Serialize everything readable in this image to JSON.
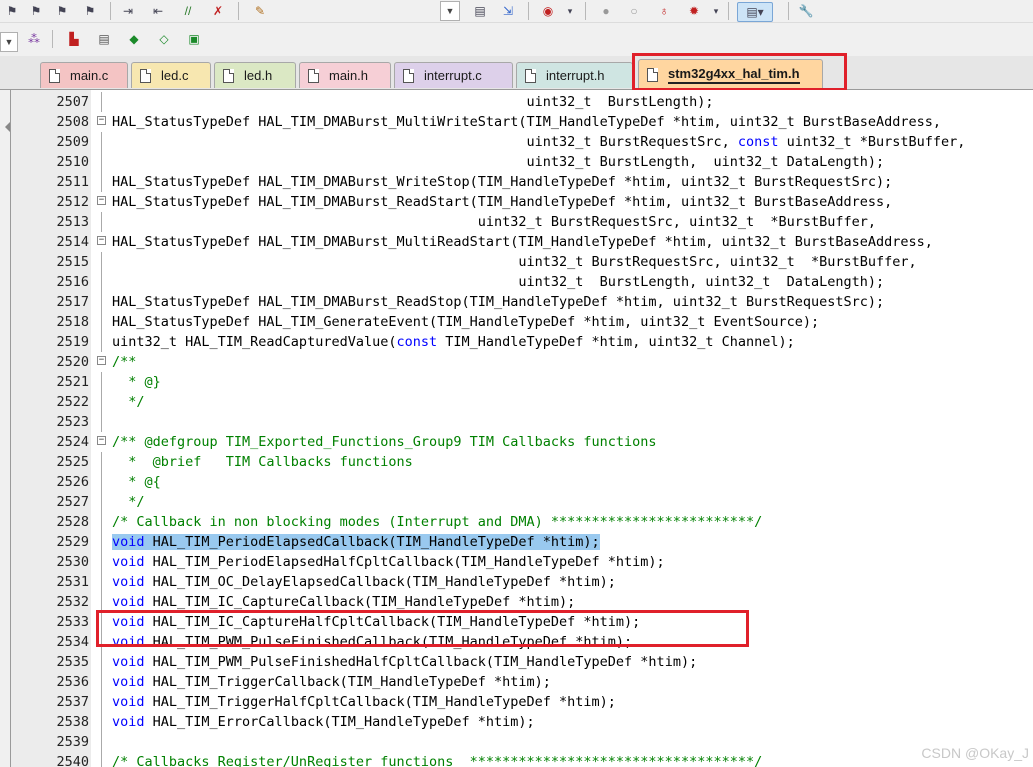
{
  "tabs": [
    {
      "label": "main.c",
      "color": "#f4c4c4",
      "active": false
    },
    {
      "label": "led.c",
      "color": "#f7e7b0",
      "active": false
    },
    {
      "label": "led.h",
      "color": "#dbe8c4",
      "active": false
    },
    {
      "label": "main.h",
      "color": "#f6cfd6",
      "active": false
    },
    {
      "label": "interrupt.c",
      "color": "#ddd0ea",
      "active": false
    },
    {
      "label": "interrupt.h",
      "color": "#cfe5e2",
      "active": false
    },
    {
      "label": "stm32g4xx_hal_tim.h",
      "color": "#ffd6a0",
      "active": true
    }
  ],
  "editor": {
    "lines": [
      {
        "num": "2507",
        "text": "                                                   uint32_t  BurstLength);"
      },
      {
        "num": "2508",
        "text": "HAL_StatusTypeDef HAL_TIM_DMABurst_MultiWriteStart(TIM_HandleTypeDef *htim, uint32_t BurstBaseAddress,"
      },
      {
        "num": "2509",
        "text": "                                                   uint32_t BurstRequestSrc, const uint32_t *BurstBuffer,"
      },
      {
        "num": "2510",
        "text": "                                                   uint32_t BurstLength,  uint32_t DataLength);"
      },
      {
        "num": "2511",
        "text": "HAL_StatusTypeDef HAL_TIM_DMABurst_WriteStop(TIM_HandleTypeDef *htim, uint32_t BurstRequestSrc);"
      },
      {
        "num": "2512",
        "text": "HAL_StatusTypeDef HAL_TIM_DMABurst_ReadStart(TIM_HandleTypeDef *htim, uint32_t BurstBaseAddress,"
      },
      {
        "num": "2513",
        "text": "                                             uint32_t BurstRequestSrc, uint32_t  *BurstBuffer,"
      },
      {
        "num": "2514",
        "text": "HAL_StatusTypeDef HAL_TIM_DMABurst_MultiReadStart(TIM_HandleTypeDef *htim, uint32_t BurstBaseAddress,"
      },
      {
        "num": "2515",
        "text": "                                                  uint32_t BurstRequestSrc, uint32_t  *BurstBuffer,"
      },
      {
        "num": "2516",
        "text": "                                                  uint32_t  BurstLength, uint32_t  DataLength);"
      },
      {
        "num": "2517",
        "text": "HAL_StatusTypeDef HAL_TIM_DMABurst_ReadStop(TIM_HandleTypeDef *htim, uint32_t BurstRequestSrc);"
      },
      {
        "num": "2518",
        "text": "HAL_StatusTypeDef HAL_TIM_GenerateEvent(TIM_HandleTypeDef *htim, uint32_t EventSource);"
      },
      {
        "num": "2519",
        "text": "uint32_t HAL_TIM_ReadCapturedValue(const TIM_HandleTypeDef *htim, uint32_t Channel);"
      },
      {
        "num": "2520",
        "text": "/**"
      },
      {
        "num": "2521",
        "text": "  * @}"
      },
      {
        "num": "2522",
        "text": "  */"
      },
      {
        "num": "2523",
        "text": ""
      },
      {
        "num": "2524",
        "text": "/** @defgroup TIM_Exported_Functions_Group9 TIM Callbacks functions"
      },
      {
        "num": "2525",
        "text": "  *  @brief   TIM Callbacks functions"
      },
      {
        "num": "2526",
        "text": "  * @{"
      },
      {
        "num": "2527",
        "text": "  */"
      },
      {
        "num": "2528",
        "text": "/* Callback in non blocking modes (Interrupt and DMA) *************************/"
      },
      {
        "num": "2529",
        "text": "void HAL_TIM_PeriodElapsedCallback(TIM_HandleTypeDef *htim);"
      },
      {
        "num": "2530",
        "text": "void HAL_TIM_PeriodElapsedHalfCpltCallback(TIM_HandleTypeDef *htim);"
      },
      {
        "num": "2531",
        "text": "void HAL_TIM_OC_DelayElapsedCallback(TIM_HandleTypeDef *htim);"
      },
      {
        "num": "2532",
        "text": "void HAL_TIM_IC_CaptureCallback(TIM_HandleTypeDef *htim);"
      },
      {
        "num": "2533",
        "text": "void HAL_TIM_IC_CaptureHalfCpltCallback(TIM_HandleTypeDef *htim);"
      },
      {
        "num": "2534",
        "text": "void HAL_TIM_PWM_PulseFinishedCallback(TIM_HandleTypeDef *htim);"
      },
      {
        "num": "2535",
        "text": "void HAL_TIM_PWM_PulseFinishedHalfCpltCallback(TIM_HandleTypeDef *htim);"
      },
      {
        "num": "2536",
        "text": "void HAL_TIM_TriggerCallback(TIM_HandleTypeDef *htim);"
      },
      {
        "num": "2537",
        "text": "void HAL_TIM_TriggerHalfCpltCallback(TIM_HandleTypeDef *htim);"
      },
      {
        "num": "2538",
        "text": "void HAL_TIM_ErrorCallback(TIM_HandleTypeDef *htim);"
      },
      {
        "num": "2539",
        "text": ""
      },
      {
        "num": "2540",
        "text": "/* Callbacks Register/UnRegister functions  ***********************************/"
      }
    ],
    "selected_line": "2529"
  },
  "watermark": "CSDN @OKay_J",
  "colors": {
    "keyword": "#0000ff",
    "comment": "#008000",
    "selection": "#99c9ef",
    "highlight_box": "#e0202a"
  },
  "toolbar": {
    "icons": [
      "indent-icon",
      "unindent-icon",
      "comment-icon",
      "uncomment-icon",
      "notepad-icon",
      "find-in-files-icon",
      "bookmark-icon",
      "debug-icon",
      "breakpoint-icon",
      "breakpoint-disable-icon",
      "kill-breakpoints-icon",
      "configure-icon",
      "window-icon",
      "tools-icon"
    ],
    "build_icons": [
      "build-target-icon",
      "rebuild-icon",
      "batch-build-icon",
      "download-icon",
      "target-options-icon"
    ]
  }
}
